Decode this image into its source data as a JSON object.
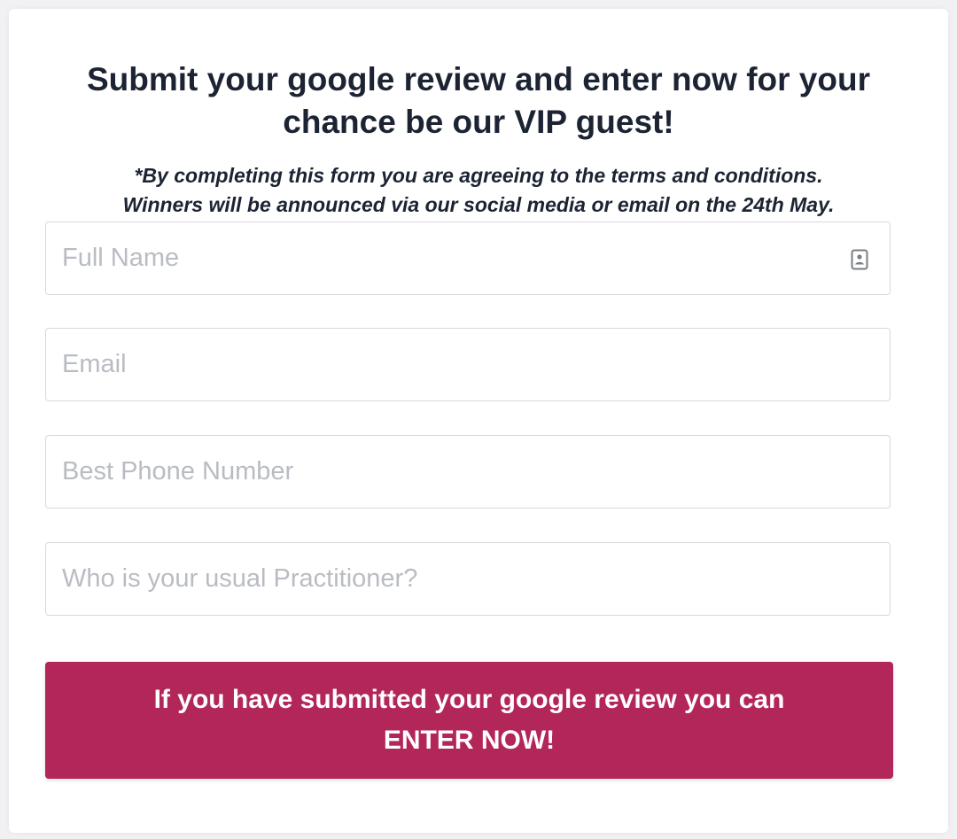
{
  "form": {
    "title": "Submit your google review and enter now for your chance be our VIP guest!",
    "subtitle_line1": "*By completing this form you are agreeing to the terms and conditions.",
    "subtitle_line2": "Winners will be announced via our social media or email on the 24th May.",
    "fields": [
      {
        "placeholder": "Full Name",
        "value": "",
        "icon": "contact-card-icon"
      },
      {
        "placeholder": "Email",
        "value": ""
      },
      {
        "placeholder": "Best Phone Number",
        "value": ""
      },
      {
        "placeholder": "Who is your usual Practitioner?",
        "value": ""
      }
    ],
    "submit_line1": "If you have submitted your google review you can",
    "submit_line2": "ENTER NOW!"
  },
  "colors": {
    "page_background": "#f1f1f3",
    "card_background": "#ffffff",
    "heading_text": "#1c2433",
    "placeholder_text": "#b9bcc2",
    "field_border": "#d7d9dd",
    "button_background": "#b3265a",
    "button_text": "#ffffff"
  }
}
